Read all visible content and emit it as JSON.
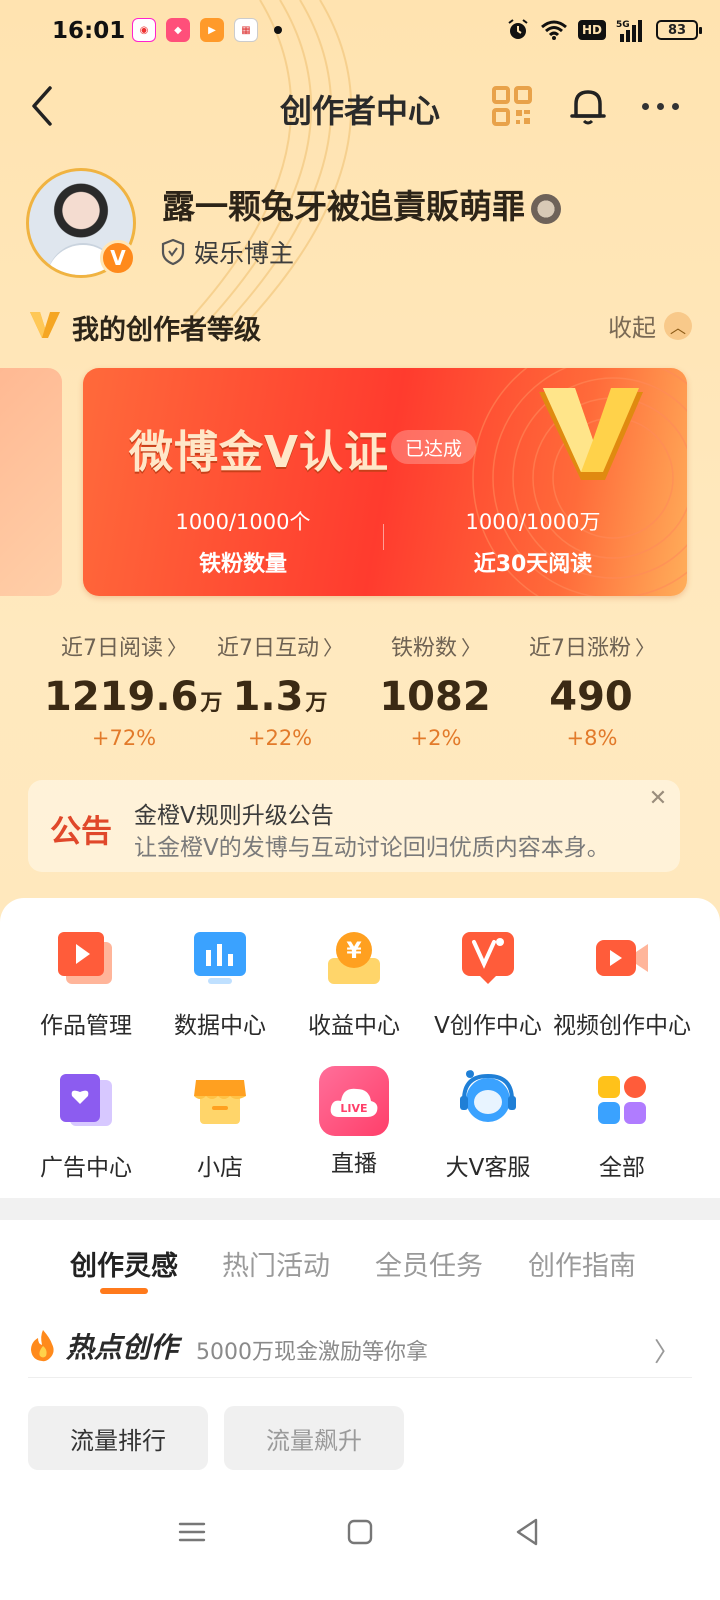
{
  "status_bar": {
    "time": "16:01",
    "battery": "83",
    "network": "HD",
    "signal": "5G"
  },
  "header": {
    "title": "创作者中心"
  },
  "profile": {
    "username": "露一颗兔牙被追責販萌罪",
    "role": "娱乐博主"
  },
  "level": {
    "title": "我的创作者等级",
    "collapse_label": "收起"
  },
  "gold_card": {
    "title": "微博金V认证",
    "badge": "已达成",
    "stats": [
      {
        "value": "1000/1000个",
        "label": "铁粉数量"
      },
      {
        "value": "1000/1000万",
        "label": "近30天阅读"
      }
    ]
  },
  "stats": [
    {
      "label": "近7日阅读",
      "value": "1219.6",
      "unit": "万",
      "change": "+72%"
    },
    {
      "label": "近7日互动",
      "value": "1.3",
      "unit": "万",
      "change": "+22%"
    },
    {
      "label": "铁粉数",
      "value": "1082",
      "unit": "",
      "change": "+2%"
    },
    {
      "label": "近7日涨粉",
      "value": "490",
      "unit": "",
      "change": "+8%"
    }
  ],
  "notice": {
    "tag": "公告",
    "title": "金橙V规则升级公告",
    "desc": "让金橙V的发博与互动讨论回归优质内容本身。"
  },
  "tools": [
    {
      "label": "作品管理",
      "icon": "works-icon"
    },
    {
      "label": "数据中心",
      "icon": "data-icon"
    },
    {
      "label": "收益中心",
      "icon": "income-icon"
    },
    {
      "label": "V创作中心",
      "icon": "v-create-icon"
    },
    {
      "label": "视频创作中心",
      "icon": "video-icon"
    },
    {
      "label": "广告中心",
      "icon": "ad-icon"
    },
    {
      "label": "小店",
      "icon": "shop-icon"
    },
    {
      "label": "直播",
      "icon": "live-icon",
      "icon_text": "LIVE"
    },
    {
      "label": "大V客服",
      "icon": "service-icon"
    },
    {
      "label": "全部",
      "icon": "all-icon"
    }
  ],
  "tabs": [
    "创作灵感",
    "热门活动",
    "全员任务",
    "创作指南"
  ],
  "hot": {
    "title": "热点创作",
    "subtitle": "5000万现金激励等你拿"
  },
  "chips": [
    "流量排行",
    "流量飙升"
  ],
  "colors": {
    "accent": "#ff7a1c",
    "card_red": "#ff3b2e",
    "notice_red": "#e0482a",
    "change_orange": "#e27a2a"
  }
}
